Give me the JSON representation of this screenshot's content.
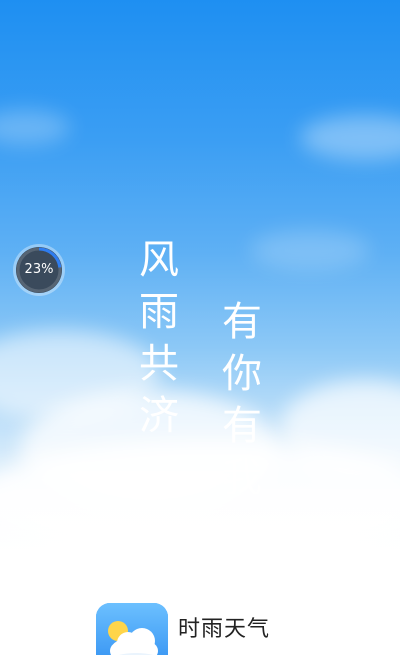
{
  "splash": {
    "slogan_line1": "风雨共济",
    "slogan_line2": "有你有我"
  },
  "skip_progress": {
    "label": "23%",
    "percent": 23
  },
  "brand": {
    "icon": "weather-cloud-sun-icon",
    "app_name": "时雨天气"
  },
  "colors": {
    "sky_top": "#1e8ff2",
    "sky_bottom": "#ffffff",
    "progress_ring": "#2e7df0",
    "progress_bg": "#3a4a5c",
    "app_icon": "#3d9ff5"
  }
}
